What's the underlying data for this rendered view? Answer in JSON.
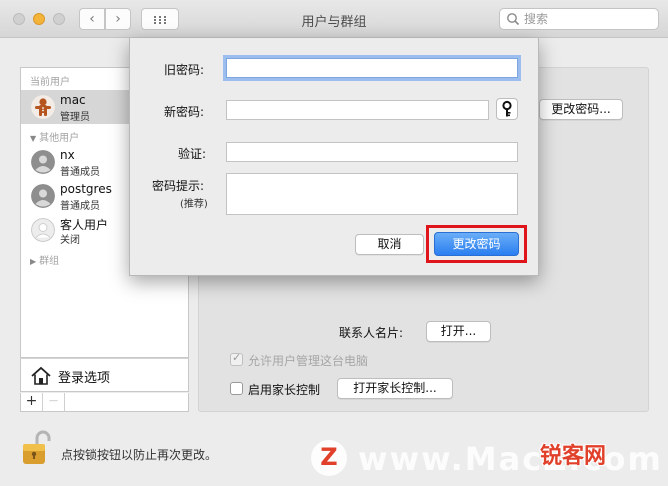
{
  "window": {
    "title": "用户与群组",
    "search_placeholder": "搜索"
  },
  "sidebar": {
    "current_users_label": "当前用户",
    "other_users_label": "其他用户",
    "groups_label": "群组",
    "current_user": {
      "name": "mac",
      "role": "管理员"
    },
    "other_users": [
      {
        "name": "nx",
        "role": "普通成员"
      },
      {
        "name": "postgres",
        "role": "普通成员"
      },
      {
        "name": "客人用户",
        "role": "关闭"
      }
    ],
    "login_options_label": "登录选项",
    "add_label": "+",
    "remove_label": "—"
  },
  "content": {
    "change_password_button": "更改密码...",
    "contact_card_label": "联系人名片:",
    "open_button": "打开...",
    "allow_admin_label": "允许用户管理这台电脑",
    "allow_admin_checked": true,
    "parental_controls_label": "启用家长控制",
    "parental_controls_checked": false,
    "open_parental_controls_button": "打开家长控制..."
  },
  "dialog": {
    "old_password_label": "旧密码:",
    "old_password_value": "",
    "new_password_label": "新密码:",
    "new_password_value": "",
    "verify_label": "验证:",
    "verify_value": "",
    "hint_label": "密码提示:",
    "hint_sublabel": "(推荐)",
    "hint_value": "",
    "cancel_button": "取消",
    "confirm_button": "更改密码",
    "highlight_color": "#e0151b",
    "accent_color": "#2a7ef0"
  },
  "footer": {
    "lock_text": "点按锁按钮以防止再次更改。"
  },
  "watermark": {
    "logo_letter": "Z",
    "text": "www.MacZ.com",
    "badge": "锐客网"
  }
}
